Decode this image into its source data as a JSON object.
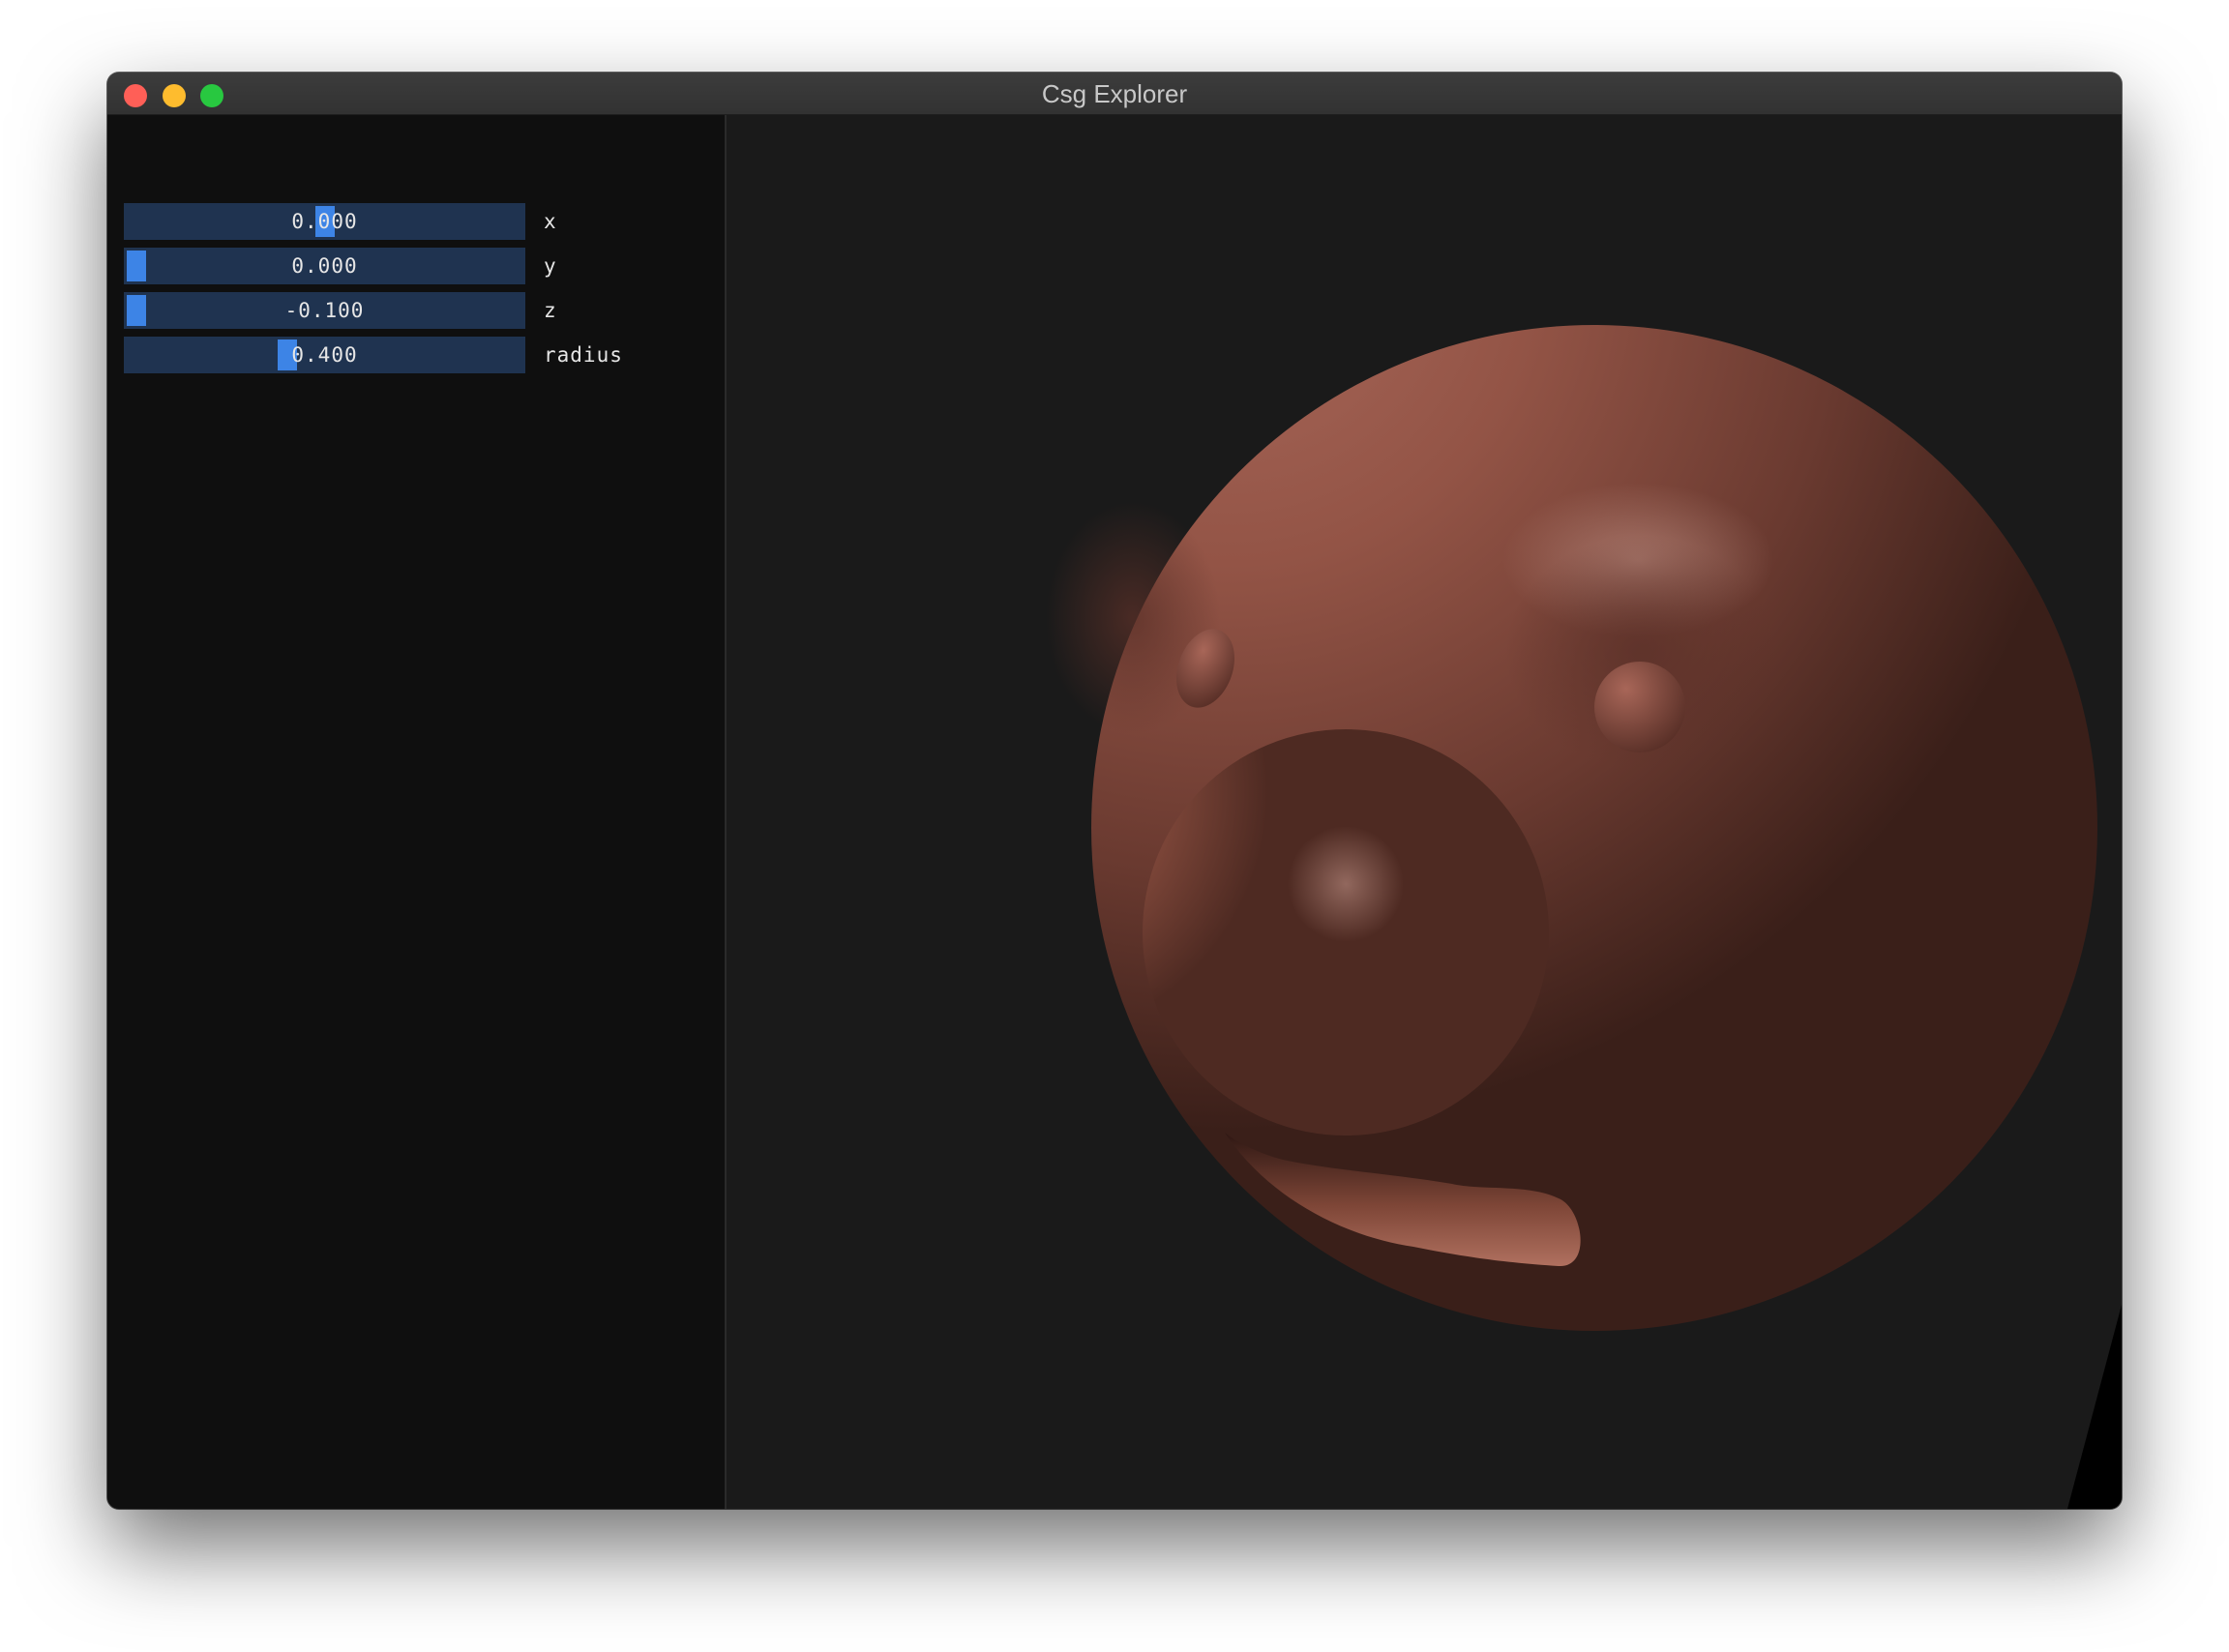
{
  "window": {
    "title": "Csg Explorer",
    "buttons": [
      {
        "name": "close",
        "color": "#ff5f57"
      },
      {
        "name": "minimize",
        "color": "#febc2e"
      },
      {
        "name": "maximize",
        "color": "#28c840"
      }
    ]
  },
  "panel": {
    "sliders": [
      {
        "label": "x",
        "value": "0.000",
        "fraction": 0.5
      },
      {
        "label": "y",
        "value": "0.000",
        "fraction": 0.0
      },
      {
        "label": "z",
        "value": "-0.100",
        "fraction": 0.0
      },
      {
        "label": "radius",
        "value": "0.400",
        "fraction": 0.4
      }
    ]
  },
  "viewport": {
    "model_color": "#8f4f42",
    "background": "#1a1a1a"
  }
}
